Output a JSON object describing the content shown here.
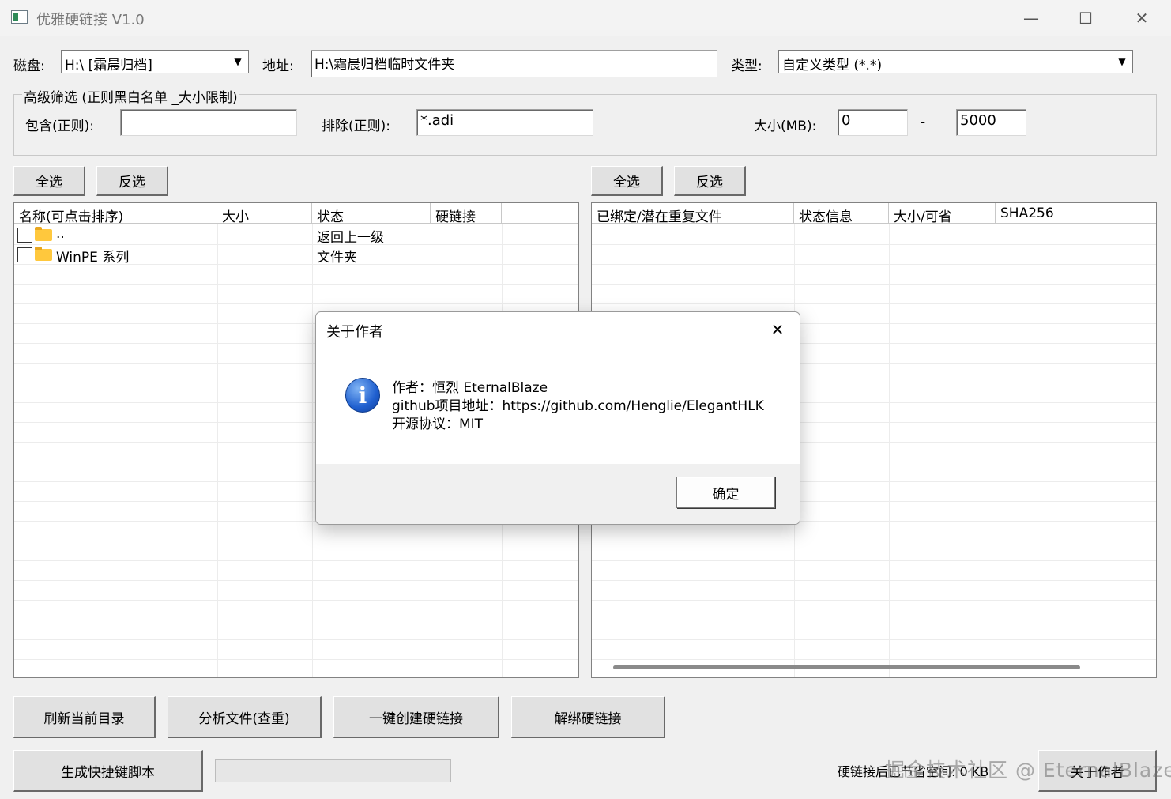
{
  "window": {
    "title": "优雅硬链接 V1.0",
    "minimize": "—",
    "maximize": "☐",
    "close": "✕"
  },
  "toolbar": {
    "disk_label": "磁盘:",
    "disk_value": "H:\\ [霜晨归档]",
    "address_label": "地址:",
    "address_value": "H:\\霜晨归档临时文件夹",
    "type_label": "类型:",
    "type_value": "自定义类型 (*.*)"
  },
  "filter": {
    "group_title": "高级筛选 (正则黑白名单 _大小限制)",
    "include_label": "包含(正则):",
    "include_value": "",
    "exclude_label": "排除(正则):",
    "exclude_value": "*.adi",
    "size_label": "大小(MB):",
    "size_min": "0",
    "size_sep": "-",
    "size_max": "5000"
  },
  "left_panel": {
    "select_all": "全选",
    "invert": "反选",
    "columns": [
      "名称(可点击排序)",
      "大小",
      "状态",
      "硬链接"
    ],
    "rows": [
      {
        "name": "..",
        "size": "",
        "status": "返回上一级",
        "hardlink": ""
      },
      {
        "name": "WinPE 系列",
        "size": "",
        "status": "文件夹",
        "hardlink": ""
      }
    ]
  },
  "right_panel": {
    "select_all": "全选",
    "invert": "反选",
    "columns": [
      "已绑定/潜在重复文件",
      "状态信息",
      "大小/可省",
      "SHA256"
    ]
  },
  "actions": {
    "refresh": "刷新当前目录",
    "analyze": "分析文件(查重)",
    "create": "一键创建硬链接",
    "unbind": "解绑硬链接",
    "script": "生成快捷键脚本",
    "status_text": "硬链接后已节省空间: 0 KB",
    "about": "关于作者"
  },
  "dialog": {
    "title": "关于作者",
    "close": "✕",
    "icon": "i",
    "line1": "作者：恒烈 EternalBlaze",
    "line2": "github项目地址：https://github.com/Henglie/ElegantHLK",
    "line3": "开源协议：MIT",
    "ok": "确定"
  },
  "watermark": "掘金技术社区 @ EternalBlaze"
}
